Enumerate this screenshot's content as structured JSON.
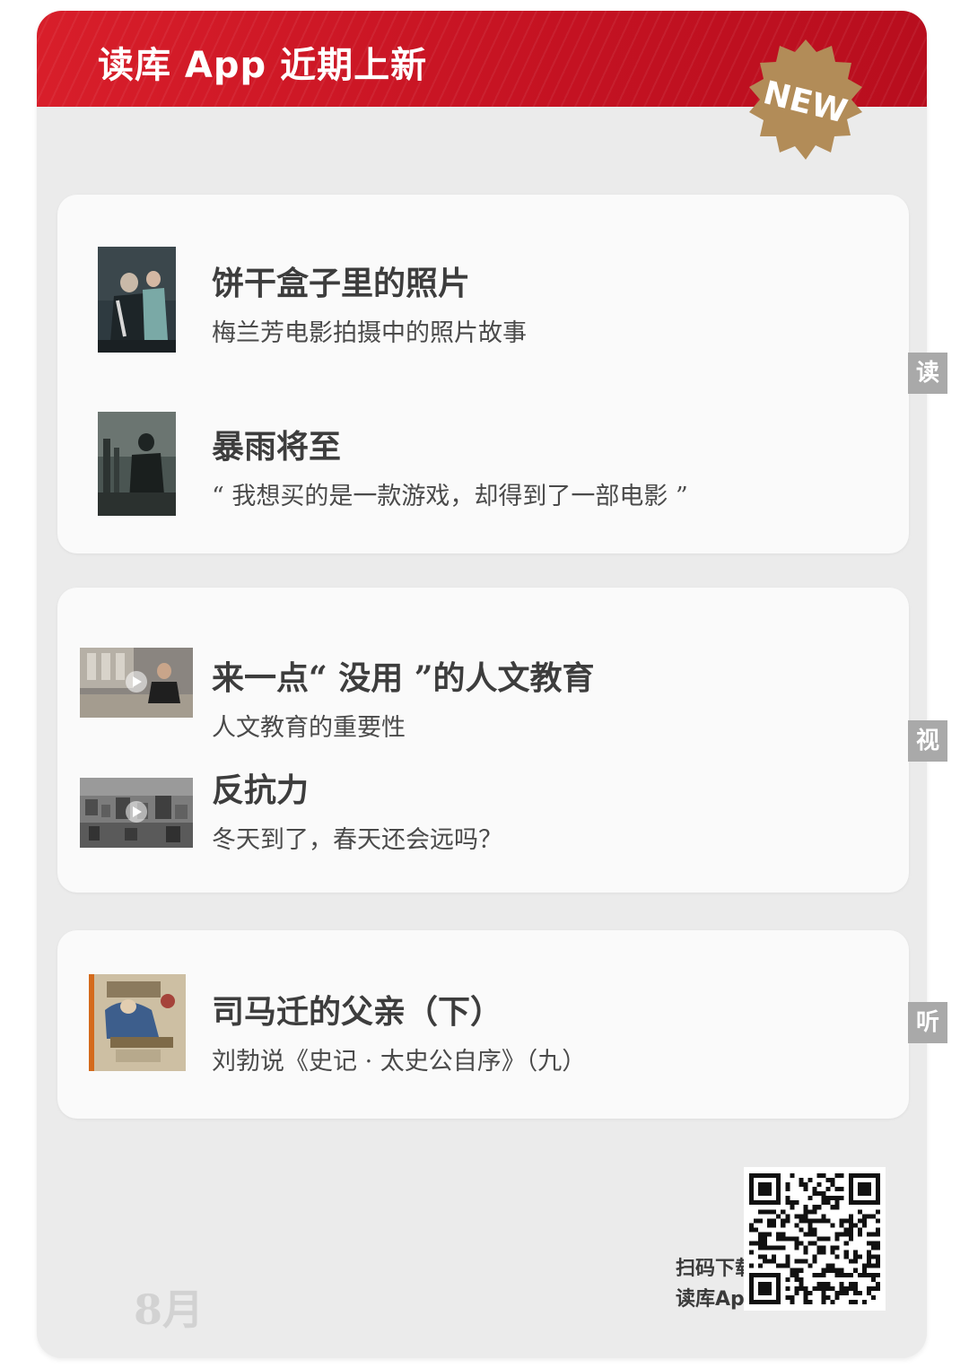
{
  "header": {
    "title": "读库 App 近期上新",
    "badge": "NEW"
  },
  "sections": [
    {
      "tab": "读",
      "items": [
        {
          "title": "饼干盒子里的照片",
          "subtitle": "梅兰芳电影拍摄中的照片故事",
          "thumb_icon": "opera-photo-thumbnail"
        },
        {
          "title": "暴雨将至",
          "subtitle": "“ 我想买的是一款游戏，却得到了一部电影 ”",
          "thumb_icon": "game-scene-thumbnail"
        }
      ]
    },
    {
      "tab": "视",
      "items": [
        {
          "title": "来一点“ 没用 ”的人文教育",
          "subtitle": "人文教育的重要性",
          "thumb_icon": "video-lecture-thumbnail"
        },
        {
          "title": "反抗力",
          "subtitle": "冬天到了，春天还会远吗？",
          "thumb_icon": "city-aerial-video-thumbnail"
        }
      ]
    },
    {
      "tab": "听",
      "items": [
        {
          "title": "司马迁的父亲（下）",
          "subtitle": "刘勃说《史记 · 太史公自序》（九）",
          "thumb_icon": "painting-book-cover"
        }
      ]
    }
  ],
  "footer": {
    "month": "8月",
    "qr_line1": "扫码下载",
    "qr_line2": "读库App",
    "qr_icon": "qr-code"
  },
  "colors": {
    "header_red": "#c41222",
    "badge_gold": "#b08d5a",
    "tab_gray": "#a9a9a9",
    "background": "#ebebeb"
  }
}
